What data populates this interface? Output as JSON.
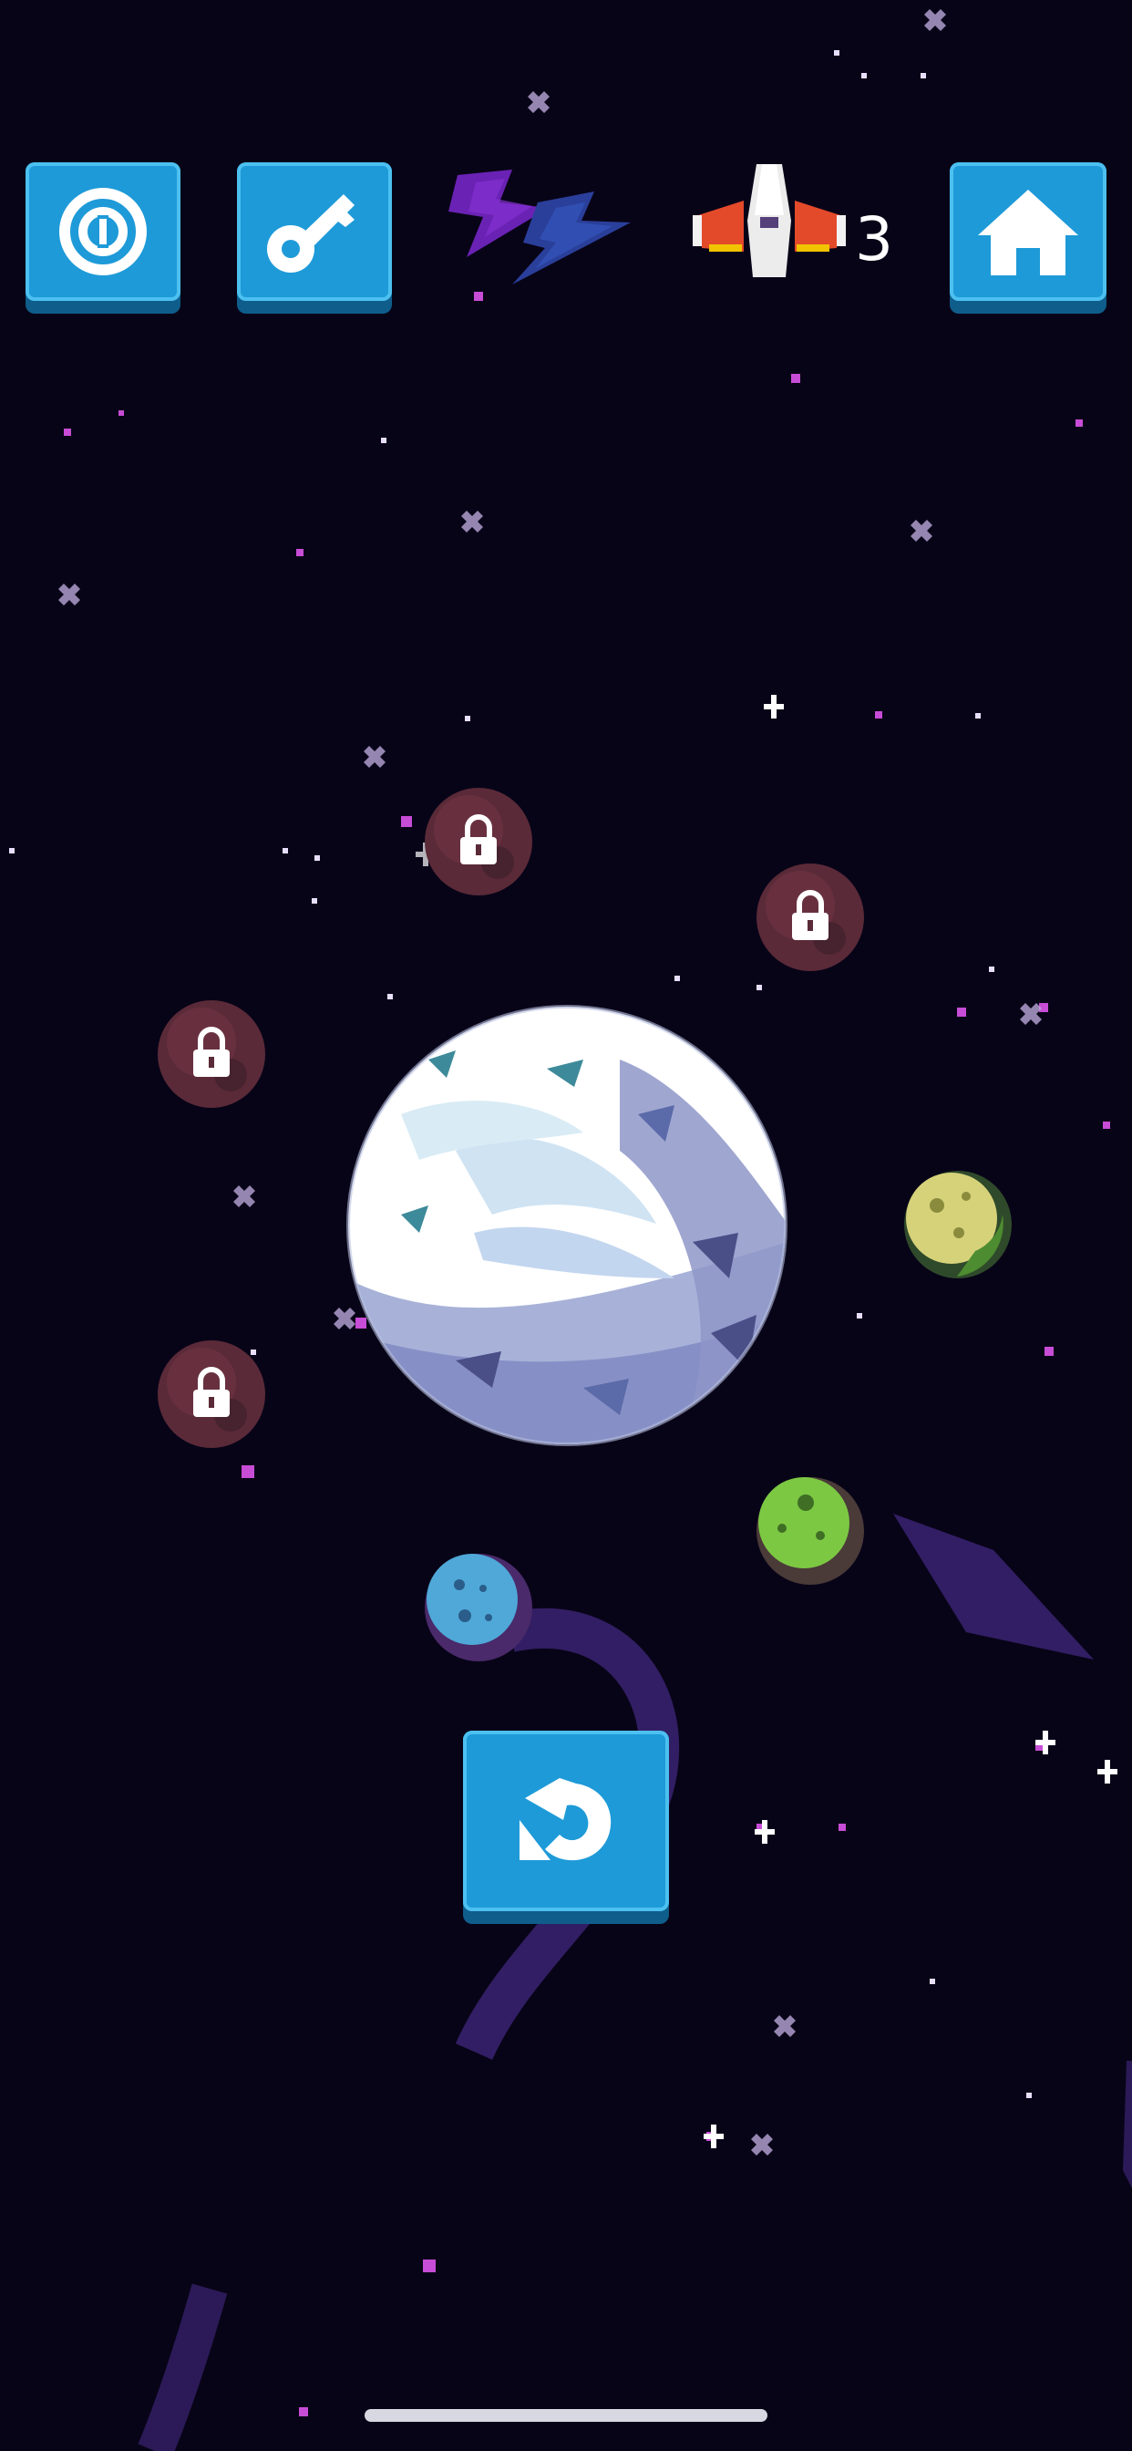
{
  "hud": {
    "ship_count": "3",
    "buttons": [
      {
        "id": "power",
        "icon": "power-icon"
      },
      {
        "id": "key",
        "icon": "key-icon"
      },
      {
        "id": "home",
        "icon": "home-icon"
      }
    ],
    "decor": [
      "lightning-bolt-icon",
      "spaceship-icon"
    ]
  },
  "level_map": {
    "center_planet": {
      "icon": "ice-planet",
      "state": "current"
    },
    "planets": [
      {
        "id": "planet-1",
        "icon": "lock-icon",
        "state": "locked",
        "color": "#5a2a38"
      },
      {
        "id": "planet-2",
        "icon": "lock-icon",
        "state": "locked",
        "color": "#5a2a38"
      },
      {
        "id": "planet-3",
        "icon": "lock-icon",
        "state": "locked",
        "color": "#5a2a38"
      },
      {
        "id": "planet-4",
        "icon": "lock-icon",
        "state": "locked",
        "color": "#5a2a38"
      },
      {
        "id": "planet-5",
        "state": "unlocked",
        "color": "#d6d27a"
      },
      {
        "id": "planet-6",
        "state": "unlocked",
        "color": "#7cc843"
      },
      {
        "id": "planet-7",
        "state": "unlocked",
        "color": "#4fa8d8"
      }
    ]
  },
  "controls": {
    "restart_icon": "restart-icon"
  },
  "colors": {
    "button": "#1e9ad8",
    "button_shadow": "#0f5d8a",
    "background": "#080418"
  }
}
